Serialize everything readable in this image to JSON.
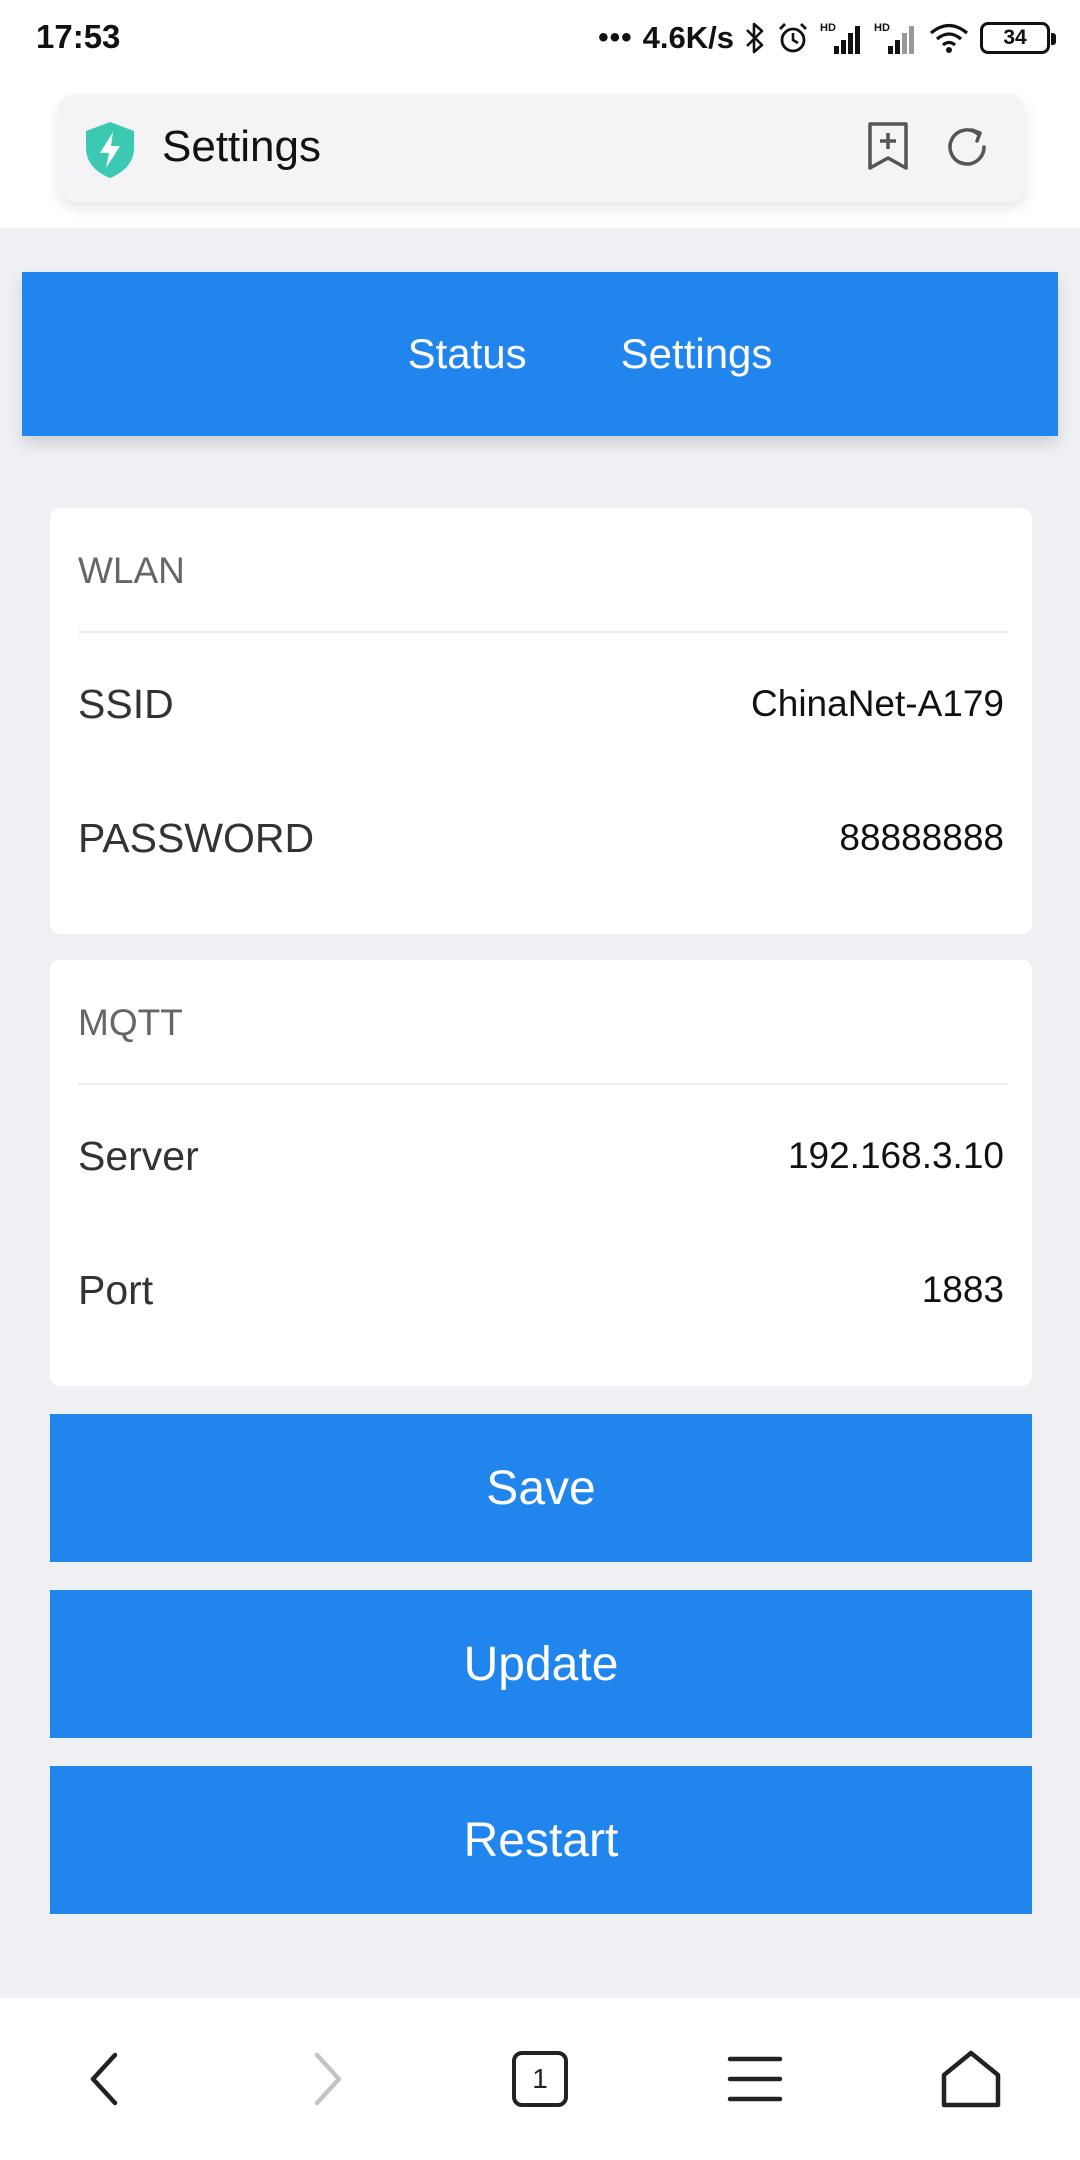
{
  "status_bar": {
    "time": "17:53",
    "dots": "•••",
    "net_speed": "4.6K/s",
    "battery": "34",
    "icons": [
      "bluetooth-icon",
      "alarm-icon",
      "hd-signal-icon",
      "hd-signal-icon",
      "wifi-icon",
      "battery-icon"
    ]
  },
  "browser": {
    "page_title": "Settings",
    "icons": [
      "shield-bolt-icon",
      "bookmark-add-icon",
      "refresh-icon"
    ]
  },
  "nav": {
    "items": [
      {
        "label": "Status"
      },
      {
        "label": "Settings"
      }
    ]
  },
  "wlan": {
    "header": "WLAN",
    "rows": [
      {
        "label": "SSID",
        "value": "ChinaNet-A179"
      },
      {
        "label": "PASSWORD",
        "value": "88888888"
      }
    ]
  },
  "mqtt": {
    "header": "MQTT",
    "rows": [
      {
        "label": "Server",
        "value": "192.168.3.10"
      },
      {
        "label": "Port",
        "value": "1883"
      }
    ]
  },
  "buttons": {
    "save": "Save",
    "update": "Update",
    "restart": "Restart"
  },
  "bottom_nav": {
    "tab_count": "1",
    "icons": [
      "back-icon",
      "forward-icon",
      "tabs-icon",
      "menu-icon",
      "home-icon"
    ]
  },
  "colors": {
    "accent": "#2185EE",
    "page_background": "#EEF0F4",
    "shield": "#3CC9B4"
  }
}
